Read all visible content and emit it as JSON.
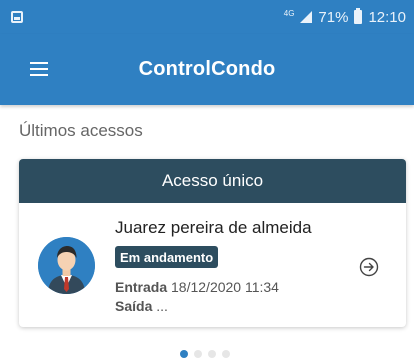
{
  "status_bar": {
    "network": "4G",
    "battery": "71%",
    "time": "12:10"
  },
  "app_bar": {
    "title": "ControlCondo",
    "menu_icon": "hamburger-menu-icon"
  },
  "section": {
    "title": "Últimos acessos"
  },
  "access_card": {
    "header": "Acesso único",
    "person_name": "Juarez pereira de almeida",
    "status": "Em andamento",
    "entry_label": "Entrada",
    "entry_value": "18/12/2020 11:34",
    "exit_label": "Saída",
    "exit_value": "...",
    "avatar_icon": "person-avatar-icon",
    "action_icon": "arrow-right-circle-icon"
  },
  "pager": {
    "count": 4,
    "active_index": 0
  },
  "colors": {
    "primary": "#2f80c2",
    "card_header": "#2d4d5f",
    "badge": "#2d4d5f"
  }
}
